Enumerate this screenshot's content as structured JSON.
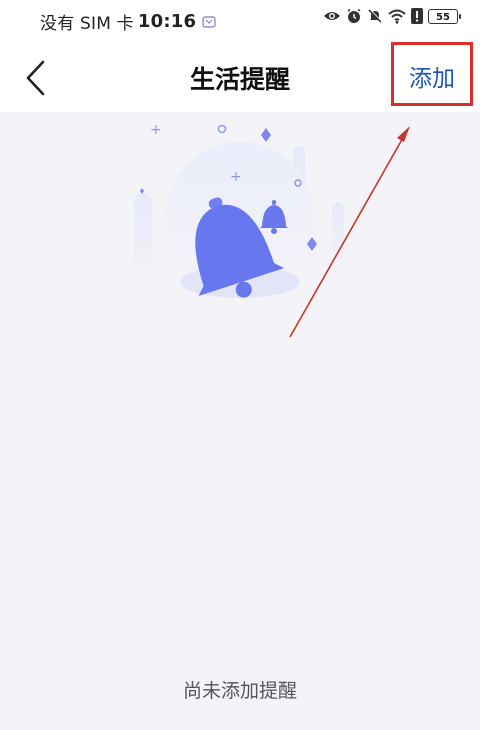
{
  "status_bar": {
    "carrier": "没有 SIM 卡",
    "time": "10:16",
    "battery": "55",
    "icons": [
      "eye-icon",
      "alarm-icon",
      "mute-icon",
      "wifi-icon",
      "alert-icon",
      "battery-icon"
    ]
  },
  "header": {
    "back_icon": "chevron-left-icon",
    "title": "生活提醒",
    "add_label": "添加"
  },
  "main": {
    "illustration": "bell-illustration",
    "empty_message": "尚未添加提醒"
  },
  "annotation": {
    "highlight_color": "#d9302b",
    "arrow_color": "#c0392b"
  },
  "colors": {
    "accent": "#6677f0",
    "link": "#1a56b4",
    "background": "#f4f3f8"
  }
}
